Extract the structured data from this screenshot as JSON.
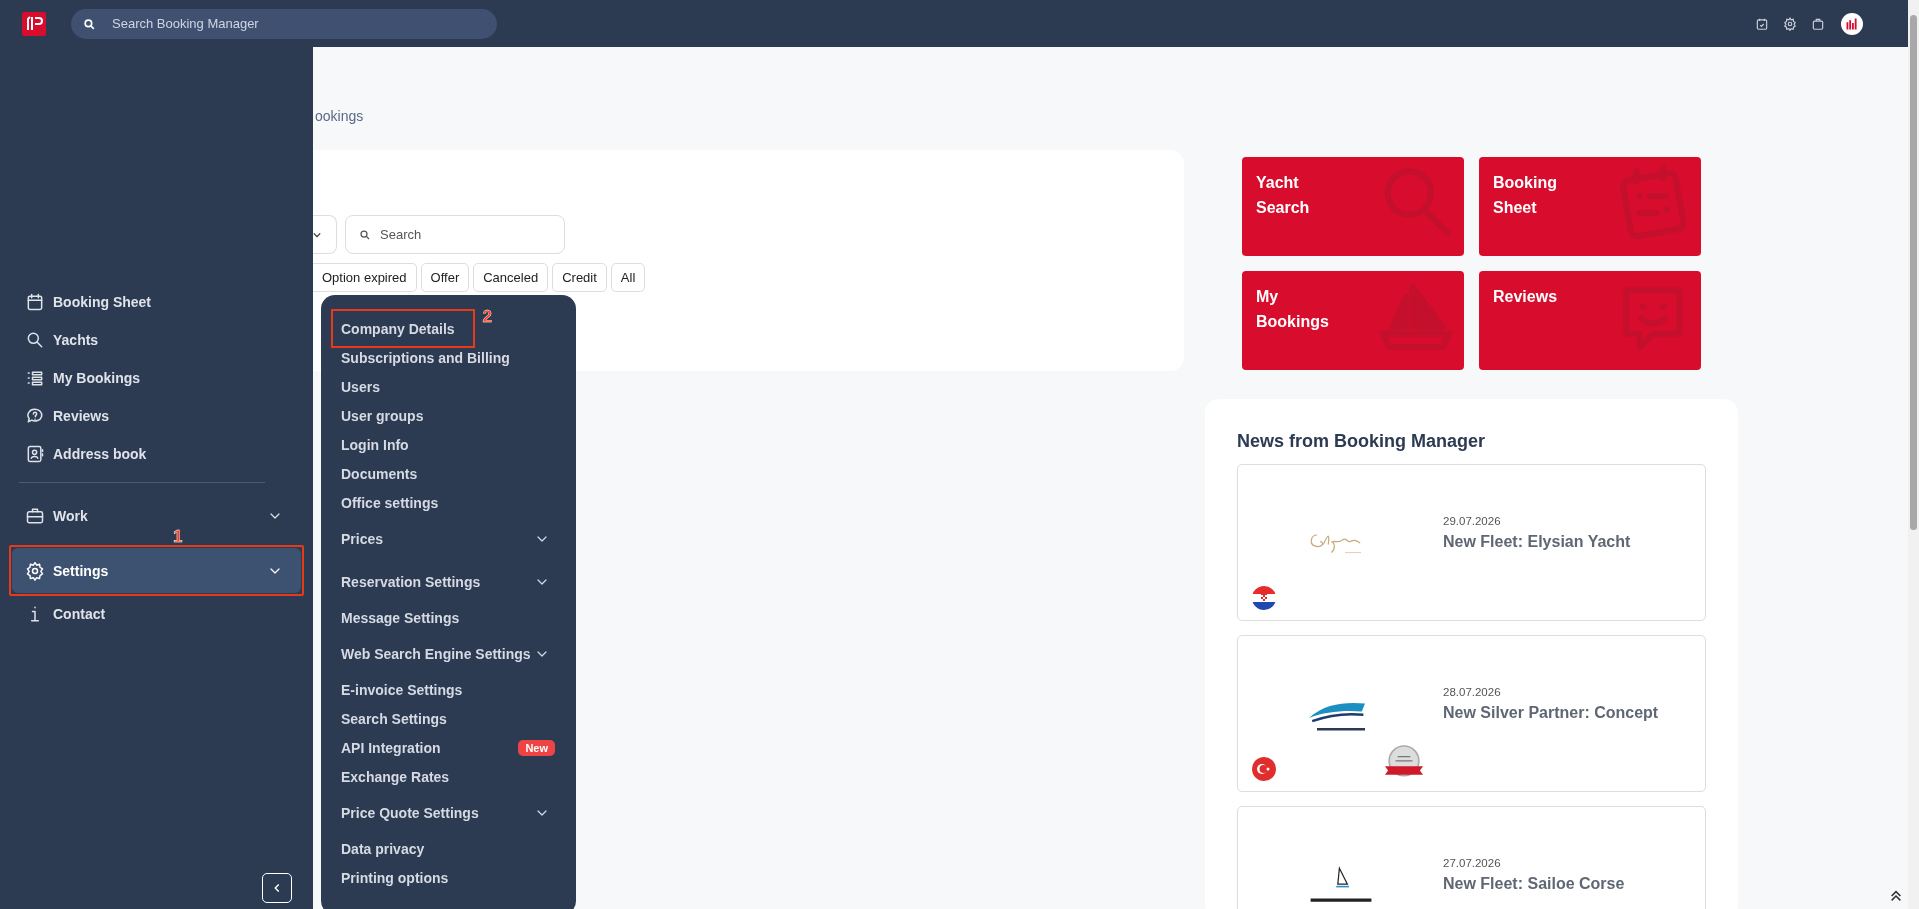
{
  "top_bar": {
    "search": {
      "placeholder": "Search Booking Manager"
    }
  },
  "sidebar": {
    "main_items": [
      {
        "label": "Booking Sheet",
        "selected": false
      },
      {
        "label": "Yachts",
        "selected": false
      },
      {
        "label": "My Bookings",
        "selected": false
      },
      {
        "label": "Reviews",
        "selected": false
      },
      {
        "label": "Address book",
        "selected": false
      }
    ],
    "more_items": [
      {
        "label": "Work",
        "kind": "group",
        "selected": false
      },
      {
        "label": "Settings",
        "kind": "group",
        "selected": true,
        "callout": "1"
      },
      {
        "label": "Contact",
        "kind": "link",
        "selected": false
      }
    ]
  },
  "breadcrumb": "ookings",
  "bookings_card": {
    "search": {
      "placeholder": "Search"
    },
    "filters": [
      "Option expired",
      "Offer",
      "Canceled",
      "Credit",
      "All"
    ]
  },
  "settings_menu": {
    "items": [
      {
        "label": "Company Details",
        "kind": "link",
        "callout": "2"
      },
      {
        "label": "Subscriptions and Billing",
        "kind": "link"
      },
      {
        "label": "Users",
        "kind": "link"
      },
      {
        "label": "User groups",
        "kind": "link"
      },
      {
        "label": "Login Info",
        "kind": "link"
      },
      {
        "label": "Documents",
        "kind": "link"
      },
      {
        "label": "Office settings",
        "kind": "link"
      },
      {
        "label": "Prices",
        "kind": "group"
      },
      {
        "label": "Reservation Settings",
        "kind": "group"
      },
      {
        "label": "Message Settings",
        "kind": "link"
      },
      {
        "label": "Web Search Engine Settings",
        "kind": "group"
      },
      {
        "label": "E-invoice Settings",
        "kind": "link"
      },
      {
        "label": "Search Settings",
        "kind": "link"
      },
      {
        "label": "API Integration",
        "kind": "link",
        "badge": "New"
      },
      {
        "label": "Exchange Rates",
        "kind": "link"
      },
      {
        "label": "Price Quote Settings",
        "kind": "group"
      },
      {
        "label": "Data privacy",
        "kind": "link"
      },
      {
        "label": "Printing options",
        "kind": "link"
      }
    ]
  },
  "tiles": [
    {
      "label": "Yacht Search"
    },
    {
      "label": "Booking Sheet"
    },
    {
      "label": "My Bookings"
    },
    {
      "label": "Reviews"
    }
  ],
  "news": {
    "title": "News from Booking Manager",
    "items": [
      {
        "date": "29.07.2026",
        "title": "New Fleet: Elysian Yacht"
      },
      {
        "date": "28.07.2026",
        "title": "New Silver Partner: Concept",
        "seal": true
      },
      {
        "date": "27.07.2026",
        "title": "New Fleet: Sailoe Corse"
      }
    ]
  }
}
